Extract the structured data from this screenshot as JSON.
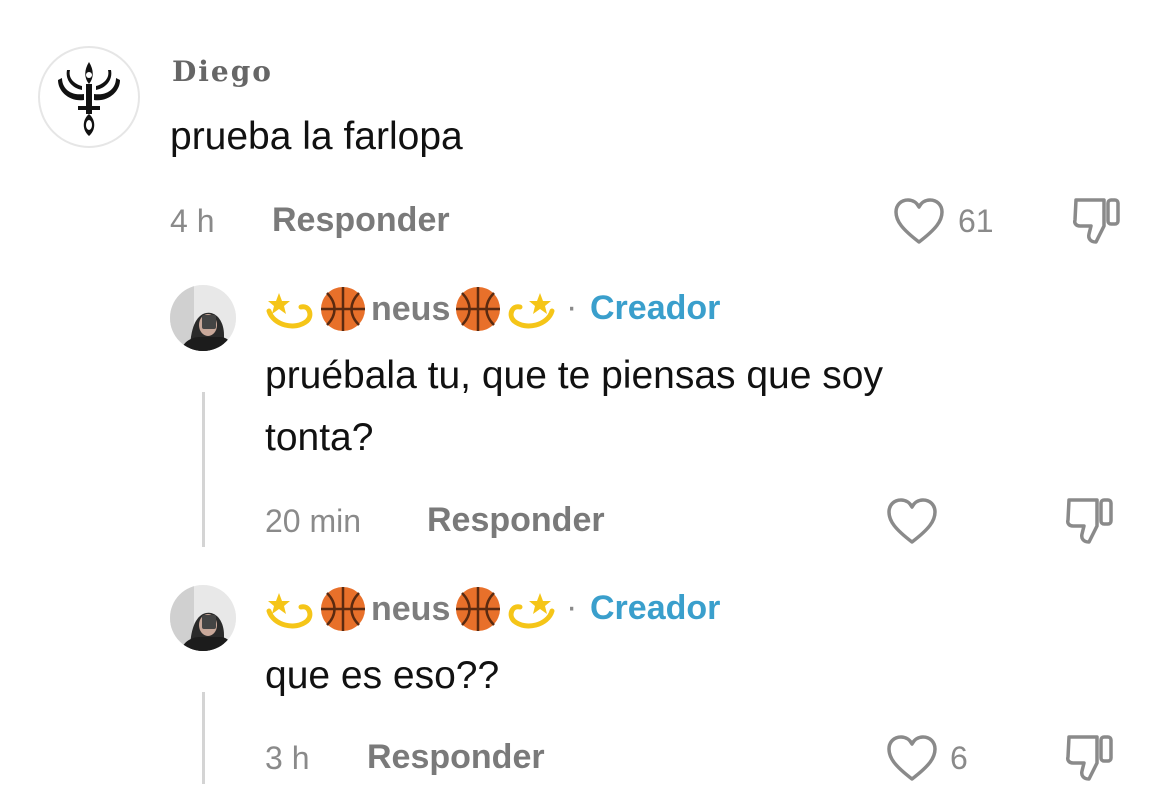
{
  "comment": {
    "username": "Diego",
    "text": "prueba la farlopa",
    "time": "4 h",
    "reply_label": "Responder",
    "likes": "61"
  },
  "replies": [
    {
      "username": "neus",
      "badge": "Creador",
      "separator": "·",
      "text_line1": "pruébala tu, que te piensas que soy",
      "text_line2": "tonta?",
      "time": "20 min",
      "reply_label": "Responder",
      "likes": ""
    },
    {
      "username": "neus",
      "badge": "Creador",
      "separator": "·",
      "text_line1": "que es eso??",
      "time": "3 h",
      "reply_label": "Responder",
      "likes": "6"
    }
  ],
  "icons": {
    "heart": "heart-outline-icon",
    "dislike": "thumbs-down-icon",
    "dizzy": "dizzy-emoji",
    "basketball": "basketball-emoji"
  },
  "colors": {
    "creator_badge": "#3a9fcc",
    "meta_text": "#8a8a8a"
  }
}
